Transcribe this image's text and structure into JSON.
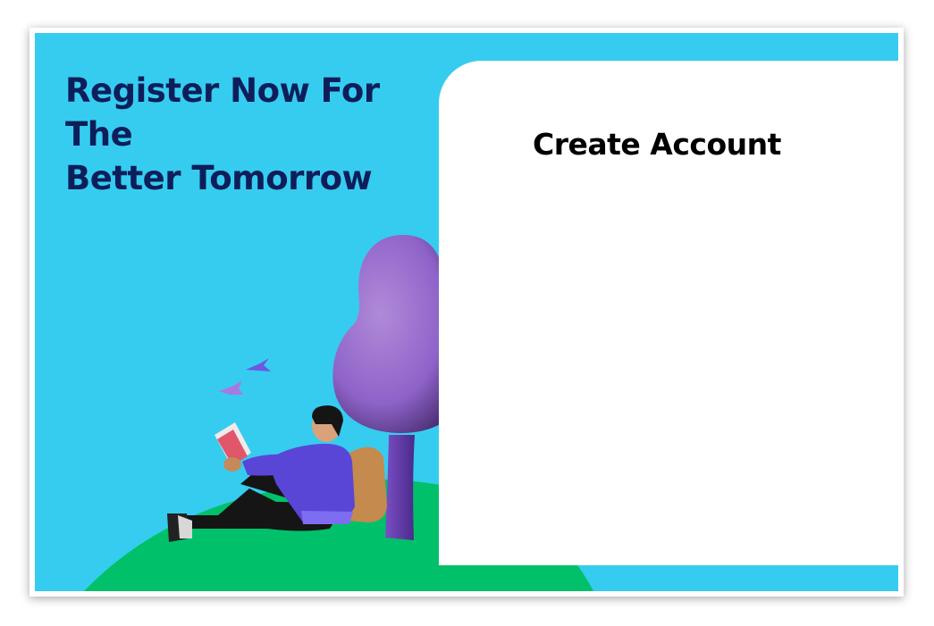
{
  "hero": {
    "headline_line1": "Register Now For The",
    "headline_line2": "Better Tomorrow"
  },
  "form": {
    "title": "Create Account"
  },
  "colors": {
    "page_bg": "#ffffff",
    "panel_bg": "#36ccef",
    "headline": "#0d1e5a",
    "hill": "#00c16a",
    "tree": "#8e63c9",
    "hoodie": "#5a46d6"
  },
  "illustration": {
    "name": "student-reading-under-tree"
  }
}
